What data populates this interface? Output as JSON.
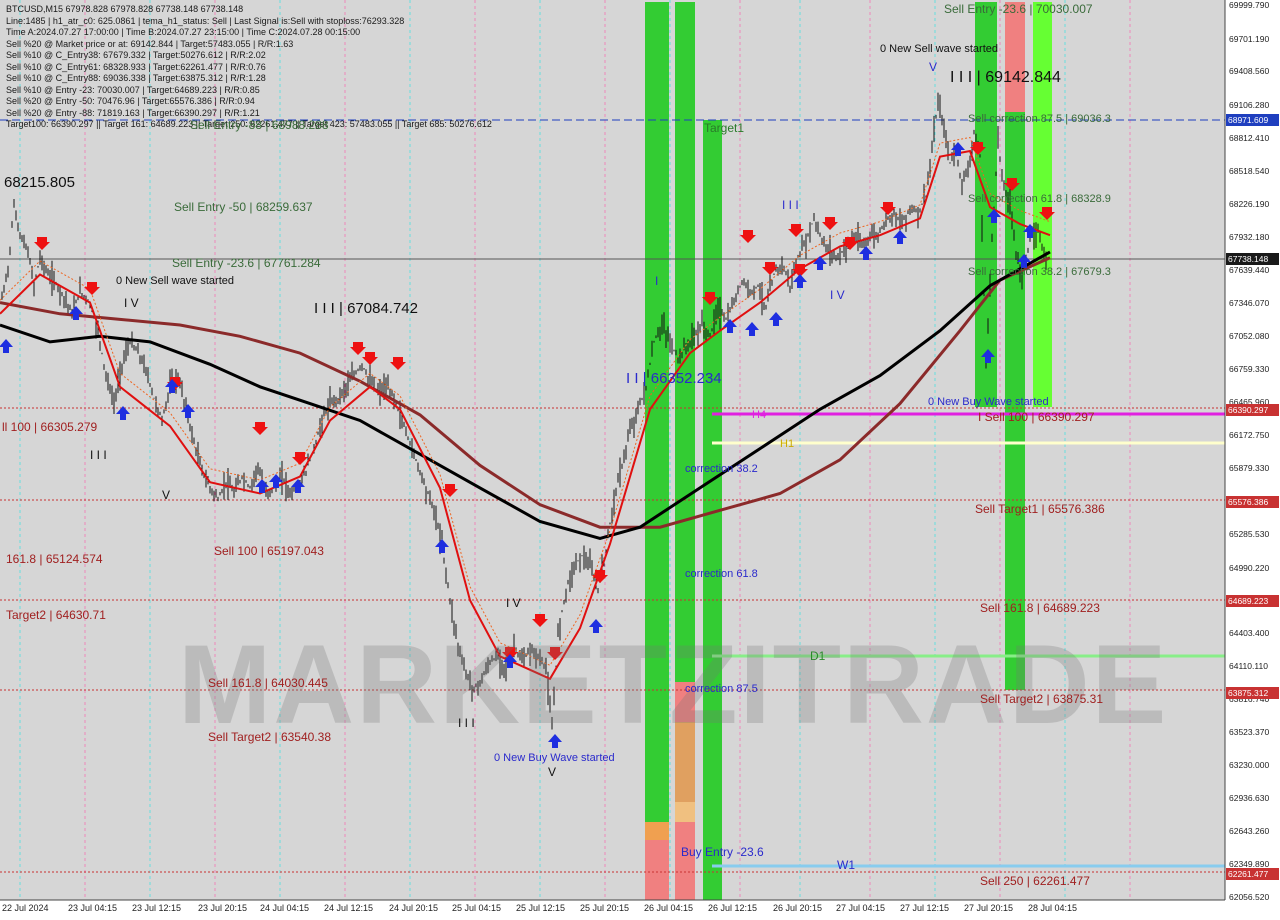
{
  "header": {
    "lines": [
      "BTCUSD,M15  67978.828 67978.828 67738.148 67738.148",
      "Line:1485 | h1_atr_c0: 625.0861 | tema_h1_status: Sell | Last Signal is:Sell with stoploss:76293.328",
      "Time A:2024.07.27 17:00:00 | Time B:2024.07.27 23:15:00 | Time C:2024.07.28 00:15:00",
      "Sell %20 @ Market price or at: 69142.844 | Target:57483.055 | R/R:1.63",
      "Sell %10 @ C_Entry38: 67679.332 | Target:50276.612 | R/R:2.02",
      "Sell %10 @ C_Entry61: 68328.933 | Target:62261.477 | R/R:0.76",
      "Sell %10 @ C_Entry88: 69036.338 | Target:63875.312 | R/R:1.28",
      "Sell %10 @ Entry -23: 70030.007 | Target:64689.223 | R/R:0.85",
      "Sell %20 @ Entry -50: 70476.96 | Target:65576.386 | R/R:0.94",
      "Sell %20 @ Entry -88: 71819.163 | Target:66390.297 | R/R:1.21",
      "Target100: 66390.297 || Target 161: 64689.223 || Target 250: 62261.477 || Target 423: 57483.055 || Target 685: 50276.612"
    ]
  },
  "watermark": "MARKETZITRADE",
  "chart_data": {
    "type": "candlestick",
    "symbol": "BTCUSD",
    "timeframe": "M15",
    "ylim": [
      62056.52,
      70000
    ],
    "yticks": [
      "69999.790",
      "69701.190",
      "69408.560",
      "69106.280",
      "68812.410",
      "68518.540",
      "68226.190",
      "67932.180",
      "67639.440",
      "67346.070",
      "67052.080",
      "66759.330",
      "66465.960",
      "66172.750",
      "65879.330",
      "65576.386",
      "65285.530",
      "64990.220",
      "64689.223",
      "64403.400",
      "64110.110",
      "63816.740",
      "63523.370",
      "63230.000",
      "62936.630",
      "62643.260",
      "62349.890",
      "62056.520"
    ],
    "x_labels": [
      "22 Jul 2024",
      "23 Jul 04:15",
      "23 Jul 12:15",
      "23 Jul 20:15",
      "24 Jul 04:15",
      "24 Jul 12:15",
      "24 Jul 20:15",
      "25 Jul 04:15",
      "25 Jul 12:15",
      "25 Jul 20:15",
      "26 Jul 04:15",
      "26 Jul 12:15",
      "26 Jul 20:15",
      "27 Jul 04:15",
      "27 Jul 12:15",
      "27 Jul 20:15",
      "28 Jul 04:15"
    ],
    "price_badges": [
      {
        "label": "68971.609",
        "value": 68971.609,
        "color": "#1f3fbf"
      },
      {
        "label": "67738.148",
        "value": 67738.148,
        "color": "#1a1a1a"
      },
      {
        "label": "66390.297",
        "value": 66390.297,
        "color": "#c83232"
      },
      {
        "label": "65576.386",
        "value": 65576.386,
        "color": "#c83232"
      },
      {
        "label": "64689.223",
        "value": 64689.223,
        "color": "#c83232"
      },
      {
        "label": "63875.312",
        "value": 63875.312,
        "color": "#c83232"
      },
      {
        "label": "62261.477",
        "value": 62261.477,
        "color": "#c83232"
      }
    ],
    "close_path": [
      [
        0,
        67300
      ],
      [
        8,
        67650
      ],
      [
        14,
        68215
      ],
      [
        20,
        67950
      ],
      [
        28,
        67800
      ],
      [
        34,
        67500
      ],
      [
        40,
        67750
      ],
      [
        48,
        67600
      ],
      [
        56,
        67520
      ],
      [
        64,
        67400
      ],
      [
        72,
        67250
      ],
      [
        80,
        67450
      ],
      [
        90,
        67350
      ],
      [
        98,
        67100
      ],
      [
        106,
        66700
      ],
      [
        114,
        66450
      ],
      [
        122,
        66800
      ],
      [
        130,
        67000
      ],
      [
        138,
        66900
      ],
      [
        146,
        66750
      ],
      [
        154,
        66500
      ],
      [
        162,
        66300
      ],
      [
        170,
        66600
      ],
      [
        178,
        66700
      ],
      [
        186,
        66400
      ],
      [
        194,
        66100
      ],
      [
        202,
        65850
      ],
      [
        210,
        65700
      ],
      [
        218,
        65600
      ],
      [
        226,
        65750
      ],
      [
        234,
        65650
      ],
      [
        242,
        65800
      ],
      [
        250,
        65700
      ],
      [
        258,
        65900
      ],
      [
        266,
        65650
      ],
      [
        274,
        65700
      ],
      [
        282,
        65800
      ],
      [
        290,
        65650
      ],
      [
        298,
        65720
      ],
      [
        306,
        65850
      ],
      [
        314,
        66050
      ],
      [
        322,
        66300
      ],
      [
        330,
        66450
      ],
      [
        338,
        66500
      ],
      [
        346,
        66600
      ],
      [
        354,
        66700
      ],
      [
        362,
        66800
      ],
      [
        370,
        66650
      ],
      [
        378,
        66550
      ],
      [
        386,
        66600
      ],
      [
        394,
        66500
      ],
      [
        402,
        66300
      ],
      [
        410,
        66100
      ],
      [
        418,
        65900
      ],
      [
        426,
        65700
      ],
      [
        434,
        65500
      ],
      [
        442,
        65200
      ],
      [
        450,
        64700
      ],
      [
        458,
        64300
      ],
      [
        466,
        64050
      ],
      [
        474,
        63900
      ],
      [
        482,
        64000
      ],
      [
        490,
        64150
      ],
      [
        498,
        64200
      ],
      [
        506,
        64100
      ],
      [
        514,
        64300
      ],
      [
        522,
        64150
      ],
      [
        530,
        64250
      ],
      [
        538,
        64200
      ],
      [
        546,
        64100
      ],
      [
        552,
        63550
      ],
      [
        558,
        64400
      ],
      [
        566,
        64800
      ],
      [
        574,
        65000
      ],
      [
        582,
        65100
      ],
      [
        590,
        65000
      ],
      [
        598,
        64800
      ],
      [
        606,
        65150
      ],
      [
        614,
        65600
      ],
      [
        622,
        65900
      ],
      [
        630,
        66200
      ],
      [
        638,
        66400
      ],
      [
        646,
        66600
      ],
      [
        654,
        67000
      ],
      [
        662,
        67150
      ],
      [
        670,
        67000
      ],
      [
        678,
        66850
      ],
      [
        686,
        66950
      ],
      [
        694,
        67050
      ],
      [
        702,
        67150
      ],
      [
        710,
        67050
      ],
      [
        718,
        67300
      ],
      [
        726,
        67200
      ],
      [
        734,
        67350
      ],
      [
        742,
        67550
      ],
      [
        750,
        67450
      ],
      [
        758,
        67500
      ],
      [
        766,
        67300
      ],
      [
        774,
        67600
      ],
      [
        782,
        67700
      ],
      [
        790,
        67500
      ],
      [
        798,
        67750
      ],
      [
        806,
        67900
      ],
      [
        814,
        68100
      ],
      [
        822,
        67900
      ],
      [
        830,
        67800
      ],
      [
        838,
        67750
      ],
      [
        846,
        67850
      ],
      [
        854,
        67950
      ],
      [
        862,
        67850
      ],
      [
        870,
        67950
      ],
      [
        878,
        67950
      ],
      [
        886,
        68100
      ],
      [
        894,
        68150
      ],
      [
        902,
        68050
      ],
      [
        910,
        68200
      ],
      [
        918,
        68150
      ],
      [
        926,
        68300
      ],
      [
        932,
        68700
      ],
      [
        938,
        69140
      ],
      [
        944,
        68900
      ],
      [
        950,
        68600
      ],
      [
        956,
        68700
      ],
      [
        962,
        68400
      ],
      [
        968,
        68550
      ],
      [
        974,
        68850
      ],
      [
        980,
        68650
      ],
      [
        986,
        66800
      ],
      [
        992,
        67900
      ],
      [
        998,
        68800
      ],
      [
        1004,
        68350
      ],
      [
        1010,
        68250
      ],
      [
        1016,
        67800
      ],
      [
        1022,
        67600
      ],
      [
        1030,
        67900
      ],
      [
        1038,
        68000
      ],
      [
        1046,
        67740
      ]
    ],
    "ma_black": [
      [
        0,
        67150
      ],
      [
        50,
        67000
      ],
      [
        100,
        67050
      ],
      [
        150,
        67000
      ],
      [
        210,
        66800
      ],
      [
        260,
        66600
      ],
      [
        310,
        66450
      ],
      [
        360,
        66300
      ],
      [
        420,
        66000
      ],
      [
        480,
        65700
      ],
      [
        540,
        65400
      ],
      [
        600,
        65250
      ],
      [
        640,
        65350
      ],
      [
        700,
        65700
      ],
      [
        760,
        66050
      ],
      [
        820,
        66400
      ],
      [
        880,
        66700
      ],
      [
        940,
        67100
      ],
      [
        990,
        67500
      ],
      [
        1050,
        67800
      ]
    ],
    "ma_brown": [
      [
        0,
        67350
      ],
      [
        60,
        67250
      ],
      [
        120,
        67200
      ],
      [
        180,
        67150
      ],
      [
        240,
        67050
      ],
      [
        300,
        66900
      ],
      [
        360,
        66650
      ],
      [
        420,
        66350
      ],
      [
        480,
        65900
      ],
      [
        540,
        65550
      ],
      [
        600,
        65350
      ],
      [
        660,
        65350
      ],
      [
        720,
        65500
      ],
      [
        780,
        65650
      ],
      [
        840,
        65950
      ],
      [
        900,
        66450
      ],
      [
        960,
        67100
      ],
      [
        1000,
        67550
      ],
      [
        1050,
        67750
      ]
    ],
    "ma_red": [
      [
        0,
        67250
      ],
      [
        40,
        67600
      ],
      [
        90,
        67350
      ],
      [
        120,
        66600
      ],
      [
        170,
        66250
      ],
      [
        210,
        65750
      ],
      [
        260,
        65650
      ],
      [
        300,
        65800
      ],
      [
        330,
        66300
      ],
      [
        370,
        66600
      ],
      [
        400,
        66400
      ],
      [
        440,
        65700
      ],
      [
        470,
        64700
      ],
      [
        500,
        64200
      ],
      [
        550,
        64000
      ],
      [
        580,
        64450
      ],
      [
        610,
        65200
      ],
      [
        650,
        66400
      ],
      [
        690,
        66900
      ],
      [
        720,
        67100
      ],
      [
        760,
        67350
      ],
      [
        800,
        67650
      ],
      [
        840,
        67850
      ],
      [
        880,
        67950
      ],
      [
        920,
        68100
      ],
      [
        940,
        68650
      ],
      [
        970,
        68700
      ],
      [
        990,
        68200
      ],
      [
        1020,
        68050
      ],
      [
        1050,
        67950
      ]
    ],
    "levels": [
      {
        "name": "Sell Entry -50",
        "price": 68259.637
      },
      {
        "name": "Sell Entry -23.6",
        "price": 67761.284
      },
      {
        "name": "Sell 100",
        "price": 66305.279
      },
      {
        "name": "Sell 100",
        "price": 65197.043
      },
      {
        "name": "Target2",
        "price": 64630.71
      },
      {
        "name": "Sell 161.8",
        "price": 64030.445
      },
      {
        "name": "Sell Target2",
        "price": 63540.38
      },
      {
        "name": "Sell Entry -23.6",
        "price": 70030.007
      },
      {
        "name": "Sell correction 87.5",
        "price": 69036.3
      },
      {
        "name": "Sell correction 61.8",
        "price": 68328.9
      },
      {
        "name": "Sell correction 38.2",
        "price": 67679.3
      },
      {
        "name": "Sell 100",
        "price": 66390.297
      },
      {
        "name": "Sell Target1",
        "price": 65576.386
      },
      {
        "name": "Sell 161.8",
        "price": 64689.223
      },
      {
        "name": "Sell Target2",
        "price": 63875.31
      },
      {
        "name": "Sell 250",
        "price": 62261.477
      }
    ]
  },
  "labels": {
    "a_68215": "68215.805",
    "sell_entry_50": "Sell Entry -50 | 68259.637",
    "sell_entry_236": "Sell Entry -23.6 | 67761.284",
    "new_sell_wave_left": "0 New Sell wave started",
    "iv_left": "I V",
    "iii_67084": "I I I | 67084.742",
    "sell100_left": "ll 100 | 66305.279",
    "iii_left": "I I I",
    "v_left": "V",
    "sell100_mid": "Sell 100 | 65197.043",
    "fib1618_left": "161.8 | 65124.574",
    "target2_left": "Target2 | 64630.71",
    "sell1618_mid": "Sell 161.8 | 64030.445",
    "sell_target2_mid": "Sell Target2 | 63540.38",
    "iv_mid": "I V",
    "iii_bottom": "I I I",
    "new_buy_wave_bottom": "0 New Buy Wave started",
    "v_bottom": "V",
    "i_66352": "I I | 66352.234",
    "i_mark": "I",
    "target1": "Target1",
    "correction382": "correction 38.2",
    "correction618": "correction 61.8",
    "correction875": "correction 87.5",
    "buy_entry": "Buy Entry -23.6",
    "h4": "H4",
    "h1": "H1",
    "d1": "D1",
    "w1": "W1",
    "iii_right": "I I I",
    "iv_right": "I V",
    "sell_entry_top": "Sell Entry -23.6 | 70030.007",
    "new_sell_wave_right": "0 New Sell wave started",
    "v_right": "V",
    "iii_69142": "I I I | 69142.844",
    "sell_corr_875": "Sell correction 87.5 | 69036.3",
    "sell_corr_618": "Sell correction 61.8 | 68328.9",
    "sell_corr_382": "Sell correction 38.2 | 67679.3",
    "new_buy_wave_right": "0 New Buy Wave started",
    "sell100_right": "I Sell 100 | 66390.297",
    "sell_target1_right": "Sell Target1 | 65576.386",
    "sell1618_right": "Sell 161.8 | 64689.223",
    "sell_target2_right": "Sell Target2 | 63875.31",
    "sell250_right": "Sell 250 | 62261.477",
    "overlap_text": "Sell Entry -88 | 68988.288"
  }
}
